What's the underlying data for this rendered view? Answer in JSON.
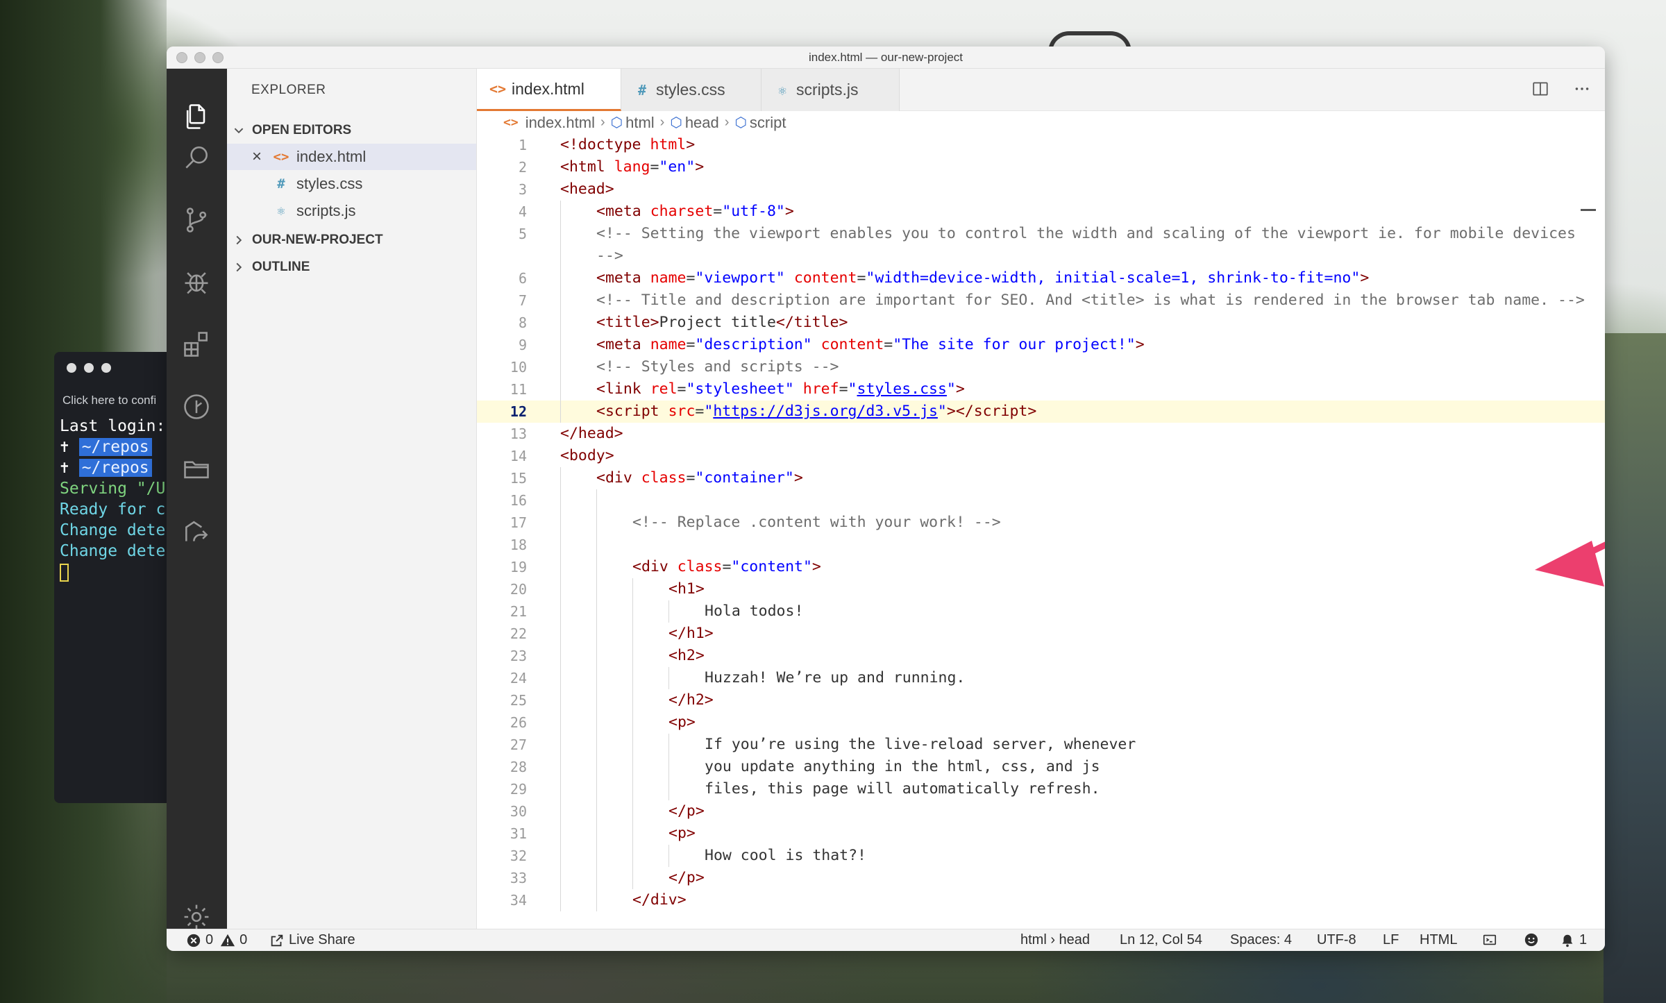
{
  "window": {
    "title": "index.html — our-new-project"
  },
  "terminal": {
    "hint": "Click here to confi",
    "lines": {
      "l0": "Last login:",
      "l1_prompt": "✝ ",
      "l1_path": "~/repos",
      "l2_prompt": "✝ ",
      "l2_path": "~/repos",
      "l3": "Serving \"/Us",
      "l4": "Ready for ch",
      "l5": "Change detec",
      "l6": "Change detec"
    }
  },
  "activity_bar": {
    "icons": [
      "files-icon",
      "search-icon",
      "source-control-icon",
      "debug-icon",
      "extensions-icon",
      "git-history-icon",
      "folder-icon",
      "live-share-icon",
      "settings-gear-icon"
    ]
  },
  "sidebar": {
    "title": "EXPLORER",
    "open_editors_label": "OPEN EDITORS",
    "open_editors": [
      {
        "name": "index.html",
        "icon": "<>",
        "selected": true
      },
      {
        "name": "styles.css",
        "icon": "#"
      },
      {
        "name": "scripts.js",
        "icon": "⚛"
      }
    ],
    "project_label": "OUR-NEW-PROJECT",
    "outline_label": "OUTLINE"
  },
  "tabs": [
    {
      "label": "index.html",
      "icon": "<>",
      "active": true
    },
    {
      "label": "styles.css",
      "icon": "#"
    },
    {
      "label": "scripts.js",
      "icon": "⚛"
    }
  ],
  "breadcrumb": {
    "file": "index.html",
    "c1": "html",
    "c2": "head",
    "c3": "script"
  },
  "editor": {
    "current_line": "12",
    "lines": {
      "n1": "1",
      "n2": "2",
      "n3": "3",
      "n4": "4",
      "n5": "5",
      "n6": "6",
      "n7": "7",
      "n8": "8",
      "n9": "9",
      "n10": "10",
      "n11": "11",
      "n12": "12",
      "n13": "13",
      "n14": "14",
      "n15": "15",
      "n16": "16",
      "n17": "17",
      "n18": "18",
      "n19": "19",
      "n20": "20",
      "n21": "21",
      "n22": "22",
      "n23": "23",
      "n24": "24",
      "n25": "25",
      "n26": "26",
      "n27": "27",
      "n28": "28",
      "n29": "29",
      "n30": "30",
      "n31": "31",
      "n32": "32",
      "n33": "33",
      "n34": "34"
    },
    "code": {
      "doctype_kw": "!doctype",
      "doctype_attr": "html",
      "lang_val": "\"en\"",
      "charset_val": "\"utf-8\"",
      "comment_viewport_1": "<!-- Setting the viewport enables you to control the width and scaling of the viewport ie. for mobile devices",
      "comment_viewport_2": "-->",
      "viewport_name": "\"viewport\"",
      "viewport_content": "\"width=device-width, initial-scale=1, shrink-to-fit=no\"",
      "comment_title": "<!-- Title and description are important for SEO. And <title> is what is rendered in the browser tab name. -->",
      "title_text": "Project title",
      "description_name": "\"description\"",
      "description_content": "\"The site for our project!\"",
      "comment_styles": "<!-- Styles and scripts -->",
      "stylesheet_rel": "\"stylesheet\"",
      "stylesheet_href": "styles.css",
      "script_src": "https://d3js.org/d3.v5.js",
      "container_class": "\"container\"",
      "comment_content": "<!-- Replace .content with your work! -->",
      "content_class": "\"content\"",
      "h1_text": "Hola todos!",
      "h2_text": "Huzzah! We’re up and running.",
      "p1_a": "If you’re using the live-reload server, whenever",
      "p1_b": "you update anything in the html, css, and js",
      "p1_c": "files, this page will automatically refresh.",
      "p2_text": "How cool is that?!"
    }
  },
  "statusbar": {
    "errors": "0",
    "warnings": "0",
    "live_share": "Live Share",
    "context": "html › head",
    "cursor": "Ln 12, Col 54",
    "spaces": "Spaces: 4",
    "encoding": "UTF-8",
    "eol": "LF",
    "language": "HTML",
    "notifications": "1"
  },
  "colors": {
    "accent": "#e37933",
    "arrow": "#ec3f6e",
    "activity_bar": "#2c2c2c"
  }
}
